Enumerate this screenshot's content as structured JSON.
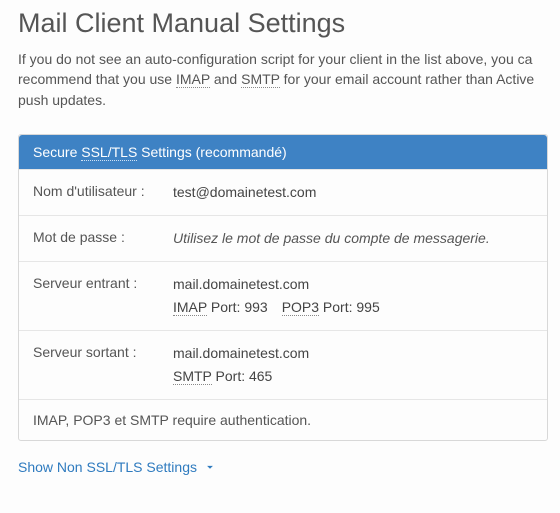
{
  "page": {
    "title": "Mail Client Manual Settings",
    "intro_parts": {
      "a": "If you do not see an auto-configuration script for your client in the list above, you ca",
      "b": " recommend that you use ",
      "imap": "IMAP",
      "c": " and ",
      "smtp": "SMTP",
      "d": " for your email account rather than Active",
      "e": " push updates."
    }
  },
  "panel": {
    "header_parts": {
      "prefix": "Secure ",
      "ssltls": "SSL/TLS",
      "suffix": " Settings (recommandé)"
    },
    "rows": {
      "username": {
        "label": "Nom d'utilisateur :",
        "value": "test@domainetest.com"
      },
      "password": {
        "label": "Mot de passe :",
        "value": "Utilisez le mot de passe du compte de messagerie."
      },
      "incoming": {
        "label": "Serveur entrant :",
        "host": "mail.domainetest.com",
        "imap_lbl": "IMAP",
        "imap_port": " Port: 993",
        "pop3_lbl": "POP3",
        "pop3_port": " Port: 995"
      },
      "outgoing": {
        "label": "Serveur sortant :",
        "host": "mail.domainetest.com",
        "smtp_lbl": "SMTP",
        "smtp_port": " Port: 465"
      }
    },
    "footer": "IMAP, POP3 et SMTP require authentication."
  },
  "toggle": {
    "label": "Show Non SSL/TLS Settings"
  }
}
